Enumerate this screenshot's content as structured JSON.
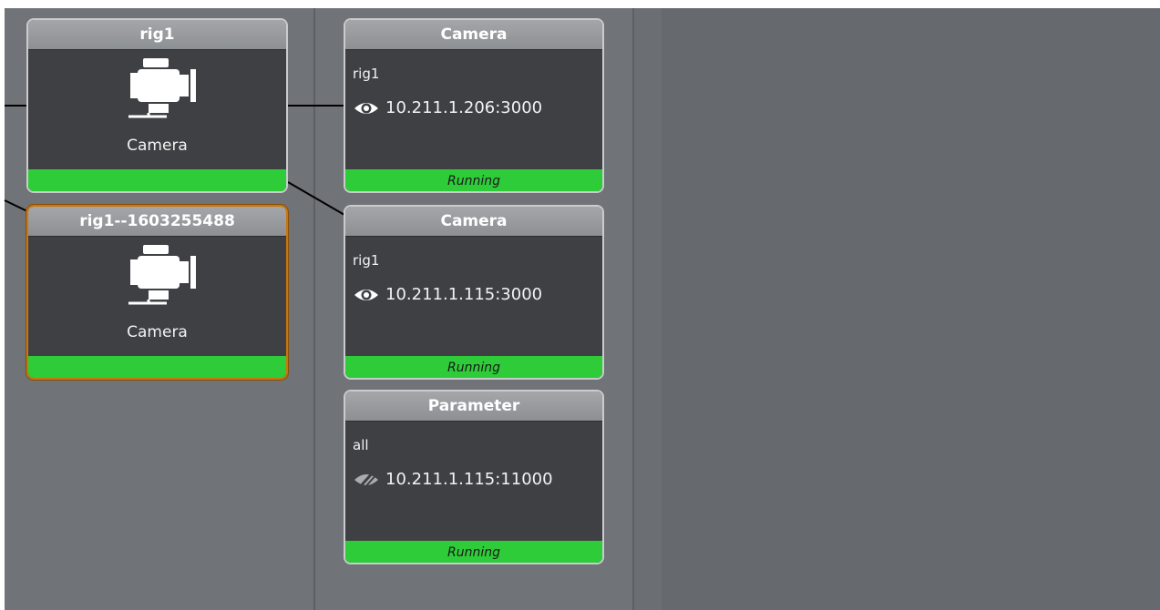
{
  "rig_nodes": [
    {
      "title": "rig1",
      "label": "Camera",
      "icon": "camera-icon"
    },
    {
      "title": "rig1--1603255488",
      "label": "Camera",
      "icon": "camera-icon"
    }
  ],
  "service_nodes": [
    {
      "title": "Camera",
      "sub": "rig1",
      "address": "10.211.1.206:3000",
      "status": "Running",
      "icon": "eye-icon"
    },
    {
      "title": "Camera",
      "sub": "rig1",
      "address": "10.211.1.115:3000",
      "status": "Running",
      "icon": "eye-icon"
    },
    {
      "title": "Parameter",
      "sub": "all",
      "address": "10.211.1.115:11000",
      "status": "Running",
      "icon": "eye-off-icon"
    }
  ],
  "colors": {
    "status_running": "#2ecc39",
    "selected_border": "#c8760d",
    "node_body": "#3e4043",
    "node_header": "#9a9c9f"
  }
}
